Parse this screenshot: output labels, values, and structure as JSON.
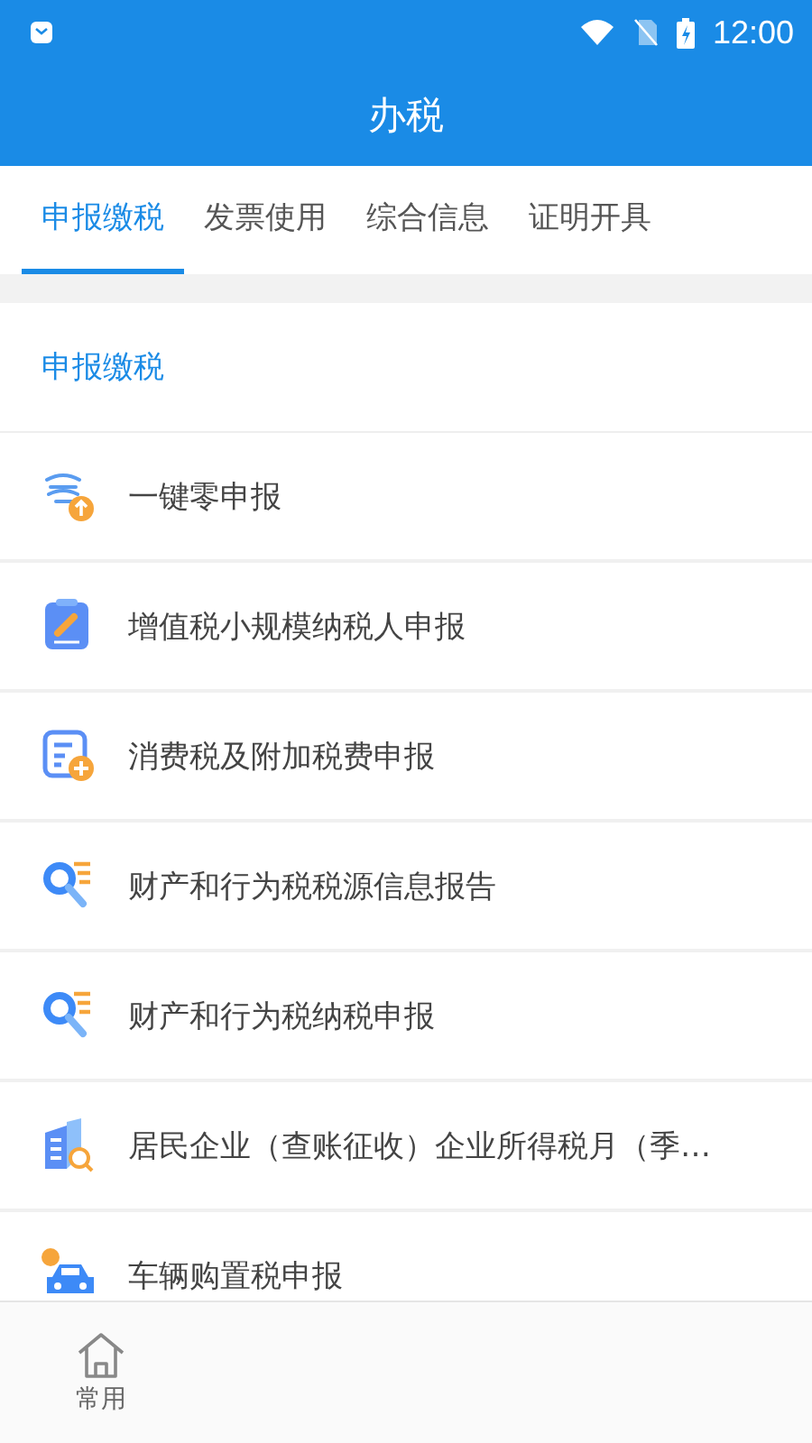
{
  "status_bar": {
    "time": "12:00"
  },
  "app_bar": {
    "title": "办税"
  },
  "tabs": [
    {
      "label": "申报缴税",
      "selected": true
    },
    {
      "label": "发票使用",
      "selected": false
    },
    {
      "label": "综合信息",
      "selected": false
    },
    {
      "label": "证明开具",
      "selected": false
    }
  ],
  "section": {
    "title": "申报缴税"
  },
  "items": [
    {
      "label": "一键零申报"
    },
    {
      "label": "增值税小规模纳税人申报"
    },
    {
      "label": "消费税及附加税费申报"
    },
    {
      "label": "财产和行为税税源信息报告"
    },
    {
      "label": "财产和行为税纳税申报"
    },
    {
      "label": "居民企业（查账征收）企业所得税月（季…"
    },
    {
      "label": "车辆购置税申报"
    }
  ],
  "bottom_nav": [
    {
      "label": "常用"
    }
  ]
}
